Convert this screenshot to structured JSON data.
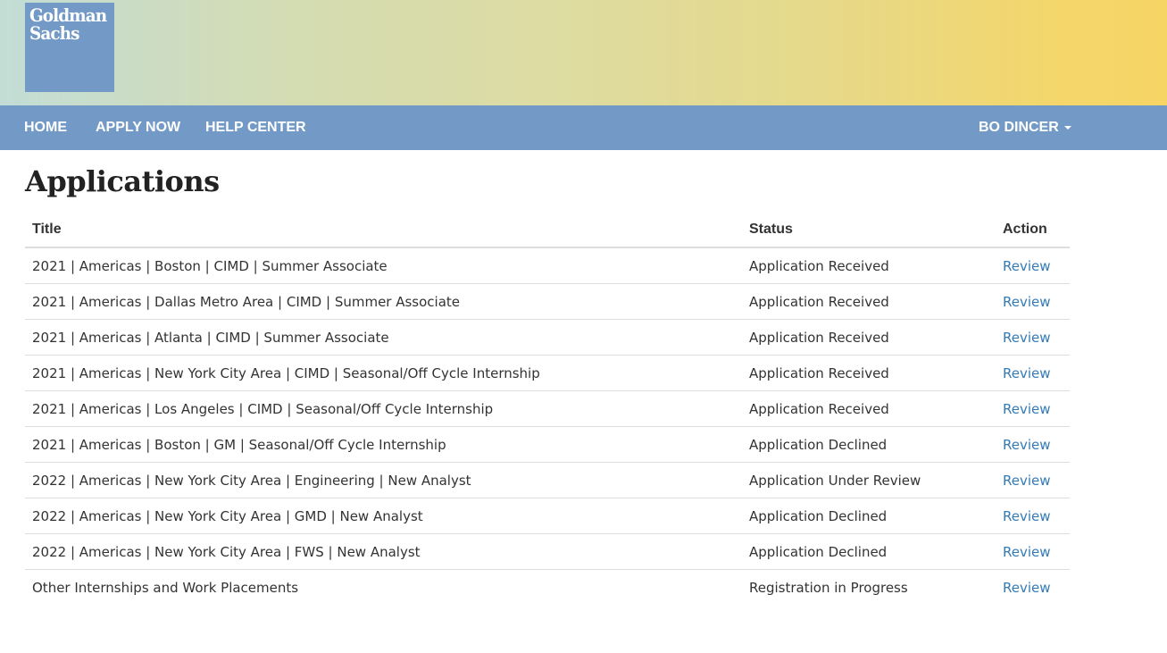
{
  "brand": {
    "logo_line1": "Goldman",
    "logo_line2": "Sachs",
    "logo_color": "#7399c6"
  },
  "nav": {
    "home": "HOME",
    "apply_now": "APPLY NOW",
    "help_center": "HELP CENTER",
    "user": "BO DINCER",
    "bar_color": "#7399c6"
  },
  "page": {
    "title": "Applications"
  },
  "table": {
    "headers": {
      "title": "Title",
      "status": "Status",
      "action": "Action"
    },
    "rows": [
      {
        "title": "2021 | Americas | Boston | CIMD | Summer Associate",
        "status": "Application Received",
        "action": "Review"
      },
      {
        "title": "2021 | Americas | Dallas Metro Area | CIMD | Summer Associate",
        "status": "Application Received",
        "action": "Review"
      },
      {
        "title": "2021 | Americas | Atlanta | CIMD | Summer Associate",
        "status": "Application Received",
        "action": "Review"
      },
      {
        "title": "2021 | Americas | New York City Area | CIMD | Seasonal/Off Cycle Internship",
        "status": "Application Received",
        "action": "Review"
      },
      {
        "title": "2021 | Americas | Los Angeles | CIMD | Seasonal/Off Cycle Internship",
        "status": "Application Received",
        "action": "Review"
      },
      {
        "title": "2021 | Americas | Boston | GM | Seasonal/Off Cycle Internship",
        "status": "Application Declined",
        "action": "Review"
      },
      {
        "title": "2022 | Americas | New York City Area | Engineering | New Analyst",
        "status": "Application Under Review",
        "action": "Review"
      },
      {
        "title": "2022 | Americas | New York City Area | GMD | New Analyst",
        "status": "Application Declined",
        "action": "Review"
      },
      {
        "title": "2022 | Americas | New York City Area | FWS | New Analyst",
        "status": "Application Declined",
        "action": "Review"
      },
      {
        "title": "Other Internships and Work Placements",
        "status": "Registration in Progress",
        "action": "Review"
      }
    ]
  }
}
